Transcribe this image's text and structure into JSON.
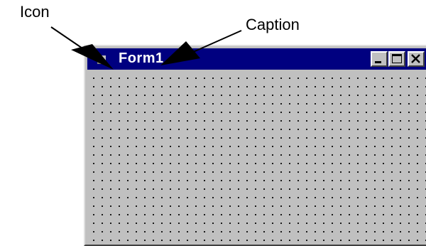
{
  "callouts": {
    "icon_label": "Icon",
    "caption_label": "Caption"
  },
  "window": {
    "title": "Form1",
    "titlebar_color": "#000080",
    "client_color": "#c0c0c0",
    "icon": "form-app-icon",
    "buttons": [
      "minimize-icon",
      "maximize-icon",
      "close-icon"
    ]
  }
}
